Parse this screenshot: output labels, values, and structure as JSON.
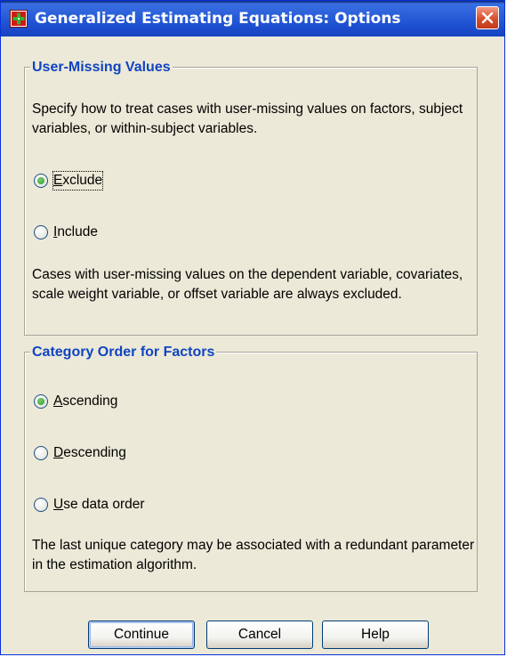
{
  "window": {
    "title": "Generalized Estimating Equations: Options",
    "icon": "spss-dialog-icon",
    "close_icon": "close-icon"
  },
  "user_missing": {
    "legend": "User-Missing Values",
    "description": "Specify how to treat cases with user-missing values on factors, subject variables, or within-subject variables.",
    "options": [
      {
        "label": "Exclude",
        "mnemonic": "E",
        "selected": true
      },
      {
        "label": "Include",
        "mnemonic": "I",
        "selected": false
      }
    ],
    "note": "Cases with user-missing values on the dependent variable, covariates, scale weight variable, or offset variable are always excluded."
  },
  "category_order": {
    "legend": "Category Order for Factors",
    "options": [
      {
        "label": "Ascending",
        "mnemonic": "A",
        "selected": true
      },
      {
        "label": "Descending",
        "mnemonic": "D",
        "selected": false
      },
      {
        "label": "Use data order",
        "mnemonic": "U",
        "selected": false
      }
    ],
    "note": "The last unique category may be associated with a redundant parameter in the estimation algorithm."
  },
  "buttons": {
    "continue": "Continue",
    "cancel": "Cancel",
    "help": "Help"
  },
  "colors": {
    "titlebar": "#1d4fd0",
    "legend_text": "#1044c2",
    "dialog_bg": "#ece9d8",
    "close_button": "#d6502e",
    "radio_dot": "#21a121"
  }
}
